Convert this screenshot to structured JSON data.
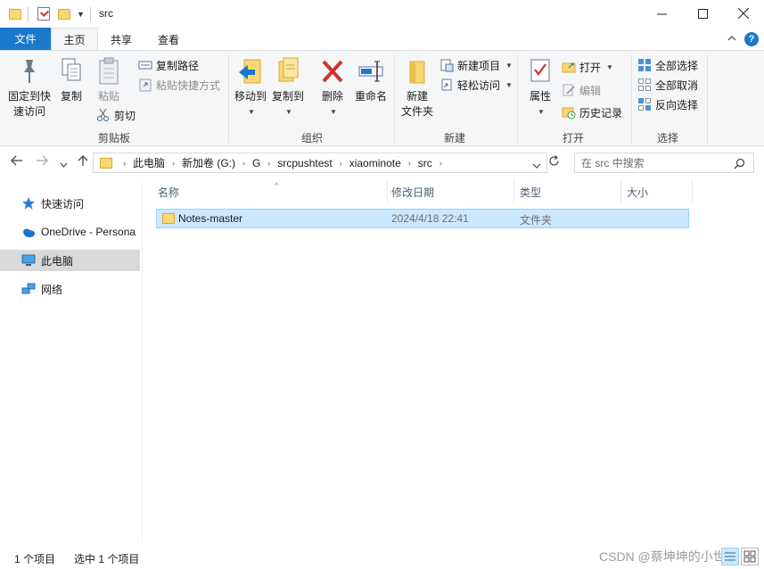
{
  "window": {
    "title": "src"
  },
  "tabs": {
    "file": "文件",
    "home": "主页",
    "share": "共享",
    "view": "查看"
  },
  "ribbon": {
    "clipboard": {
      "label": "剪贴板",
      "pin_line1": "固定到快",
      "pin_line2": "速访问",
      "copy": "复制",
      "paste": "粘贴",
      "copy_path": "复制路径",
      "paste_shortcut": "粘贴快捷方式",
      "cut": "剪切"
    },
    "organize": {
      "label": "组织",
      "move_to": "移动到",
      "copy_to": "复制到",
      "delete": "删除",
      "rename": "重命名"
    },
    "new": {
      "label": "新建",
      "new_folder_line1": "新建",
      "new_folder_line2": "文件夹",
      "new_item": "新建项目",
      "easy_access": "轻松访问"
    },
    "open": {
      "label": "打开",
      "properties": "属性",
      "open": "打开",
      "edit": "编辑",
      "history": "历史记录"
    },
    "select": {
      "label": "选择",
      "select_all": "全部选择",
      "select_none": "全部取消",
      "invert": "反向选择"
    }
  },
  "address": {
    "crumbs": [
      "此电脑",
      "新加卷 (G:)",
      "G",
      "srcpushtest",
      "xiaominote",
      "src"
    ]
  },
  "search": {
    "placeholder": "在 src 中搜索"
  },
  "nav": {
    "quick_access": "快速访问",
    "onedrive": "OneDrive - Persona",
    "this_pc": "此电脑",
    "network": "网络"
  },
  "columns": {
    "name": "名称",
    "modified": "修改日期",
    "type": "类型",
    "size": "大小"
  },
  "files": [
    {
      "name": "Notes-master",
      "modified": "2024/4/18 22:41",
      "type": "文件夹",
      "size": ""
    }
  ],
  "status": {
    "count": "1 个项目",
    "selected": "选中 1 个项目"
  },
  "watermark": "CSDN @蔡坤坤的小世界",
  "colors": {
    "accent": "#1979ca",
    "folder": "#f8d775",
    "selection": "#cce8ff",
    "delete_red": "#d0342c"
  }
}
